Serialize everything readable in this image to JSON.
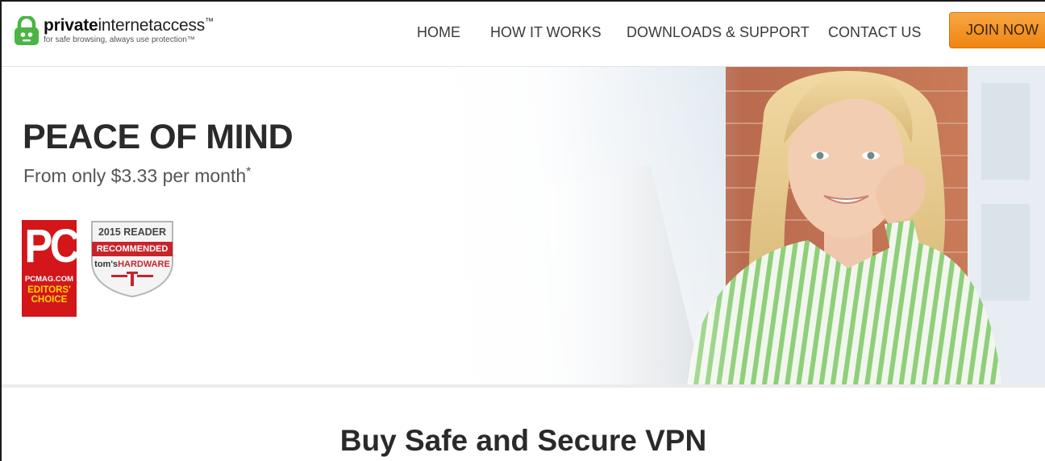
{
  "brand": {
    "name_bold": "private",
    "name_rest": "internetaccess",
    "trademark": "™",
    "tagline": "for safe browsing, always use protection™"
  },
  "nav": {
    "home": "HOME",
    "how_it_works": "HOW IT WORKS",
    "downloads_support": "DOWNLOADS & SUPPORT",
    "contact_us": "CONTACT US",
    "join_now": "JOIN NOW"
  },
  "hero": {
    "title": "PEACE OF MIND",
    "subtitle": "From only $3.33 per month",
    "subtitle_mark": "*"
  },
  "badges": {
    "pc": {
      "letters": "PC",
      "site": "PCMAG.COM",
      "line1": "EDITORS'",
      "line2": "CHOICE"
    },
    "toms": {
      "year": "2015 READER",
      "recommended": "RECOMMENDED",
      "brand_prefix": "tom's",
      "brand_suffix": "HARDWARE"
    }
  },
  "section": {
    "title": "Buy Safe and Secure VPN"
  },
  "colors": {
    "join_button": "#f39a2b",
    "brand_green": "#4bb543",
    "pc_red": "#d2161a",
    "pc_yellow": "#ffd400"
  }
}
